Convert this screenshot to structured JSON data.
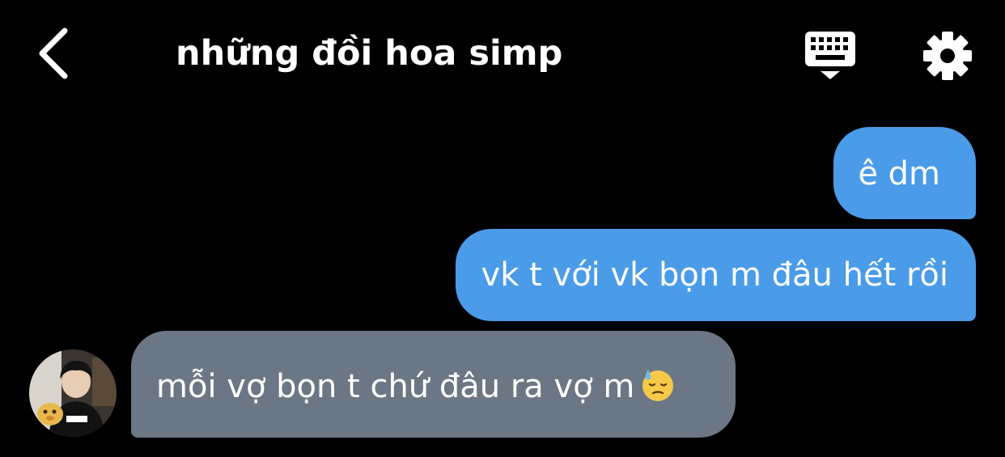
{
  "header": {
    "title": "những đồi hoa simp",
    "back_icon": "chevron-left-icon",
    "keyboard_icon": "keyboard-icon",
    "settings_icon": "gear-icon"
  },
  "messages": [
    {
      "direction": "sent",
      "text": "ê dm"
    },
    {
      "direction": "sent",
      "text": "vk t với vk bọn m đâu hết rồi"
    },
    {
      "direction": "received",
      "text": "mỗi vợ bọn t chứ đâu ra vợ m",
      "emoji": "downcast-face-with-sweat-emoji"
    }
  ],
  "colors": {
    "background": "#000000",
    "sent_bubble": "#4a9be8",
    "received_bubble": "#6b7785",
    "text": "#ffffff"
  }
}
